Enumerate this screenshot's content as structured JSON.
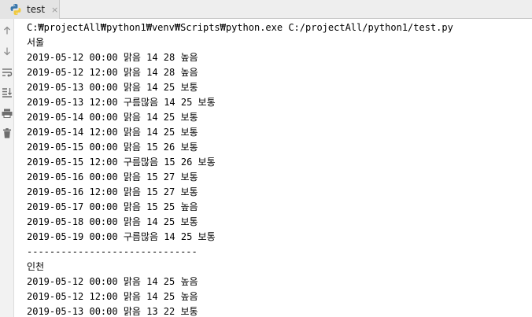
{
  "tab": {
    "label": "test",
    "close": "×",
    "icon": "python-icon"
  },
  "gutter": {
    "icons": [
      "up-arrow-icon",
      "down-arrow-icon",
      "soft-wrap-icon",
      "scroll-to-end-icon",
      "print-icon",
      "trash-icon"
    ]
  },
  "colors": {
    "python_blue": "#3776ab",
    "python_yellow": "#f0c93d",
    "gutter_icon": "#8c8c8c"
  },
  "console": {
    "lines": [
      "C:₩projectAll₩python1₩venv₩Scripts₩python.exe C:/projectAll/python1/test.py",
      "서울",
      "2019-05-12 00:00 맑음 14 28 높음",
      "2019-05-12 12:00 맑음 14 28 높음",
      "2019-05-13 00:00 맑음 14 25 보통",
      "2019-05-13 12:00 구름많음 14 25 보통",
      "2019-05-14 00:00 맑음 14 25 보통",
      "2019-05-14 12:00 맑음 14 25 보통",
      "2019-05-15 00:00 맑음 15 26 보통",
      "2019-05-15 12:00 구름많음 15 26 보통",
      "2019-05-16 00:00 맑음 15 27 보통",
      "2019-05-16 12:00 맑음 15 27 보통",
      "2019-05-17 00:00 맑음 15 25 높음",
      "2019-05-18 00:00 맑음 14 25 보통",
      "2019-05-19 00:00 구름많음 14 25 보통",
      "------------------------------",
      "인천",
      "2019-05-12 00:00 맑음 14 25 높음",
      "2019-05-12 12:00 맑음 14 25 높음",
      "2019-05-13 00:00 맑음 13 22 보통"
    ]
  }
}
